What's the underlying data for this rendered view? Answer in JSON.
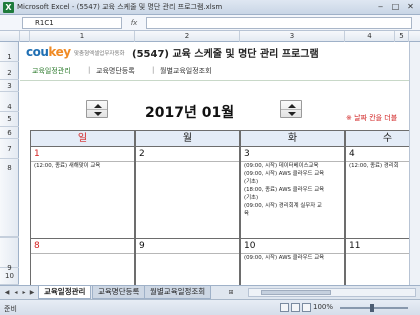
{
  "window": {
    "title": "Microsoft Excel - (5547) 교육 스케줄 및 명단 관리 프로그램.xlsm",
    "app_icon": "excel-icon"
  },
  "formula_bar": {
    "name_box": "R1C1",
    "fx": "fx",
    "value": ""
  },
  "columns": [
    "1",
    "2",
    "3",
    "4",
    "5"
  ],
  "rows": [
    "1",
    "2",
    "3",
    "4",
    "5",
    "6",
    "7",
    "8",
    "9",
    "10"
  ],
  "header": {
    "logo_co": "cou",
    "logo_key": "key",
    "tagline": "맞춤형엑셀업무자동화",
    "title": "(5547) 교육 스케줄 및 명단 관리 프로그램"
  },
  "nav": {
    "items": [
      "교육일정관리",
      "교육명단등록",
      "월별교육일정조회"
    ],
    "separator": "|"
  },
  "calendar": {
    "month_label": "2017년 01월",
    "hint": "※ 날짜 칸을 더블",
    "weekdays": [
      "일",
      "월",
      "화",
      "수"
    ],
    "weeks": [
      [
        {
          "day": "1",
          "events": [
            "(12:00, 종료) 새해맞이 교육"
          ]
        },
        {
          "day": "2",
          "events": []
        },
        {
          "day": "3",
          "events": [
            "(09:00, 시작) 데이터베이스교육",
            "(09:00, 시작) AWS 클라우드 교육",
            "(기초)",
            "(18:00, 종료) AWS 클라우드 교육",
            "(기초)",
            "(09:00, 시작) 경리회계 실무자 교",
            "육"
          ]
        },
        {
          "day": "4",
          "events": [
            "(12:00, 종료) 경리회"
          ]
        }
      ],
      [
        {
          "day": "8",
          "events": []
        },
        {
          "day": "9",
          "events": []
        },
        {
          "day": "10",
          "events": [
            "(09:00, 시작) AWS 클라우드 교육"
          ]
        },
        {
          "day": "11",
          "events": []
        }
      ]
    ]
  },
  "sheet_tabs": [
    "교육일정관리",
    "교육명단등록",
    "월별교육일정조회"
  ],
  "status": {
    "ready": "준비",
    "zoom": "100%"
  },
  "colors": {
    "sunday": "#d42020",
    "weekday_header_bg": "#e4ecf7",
    "logo_blue": "#1f6fb3",
    "logo_orange": "#f08a24",
    "active_nav": "#2b7a2b"
  }
}
